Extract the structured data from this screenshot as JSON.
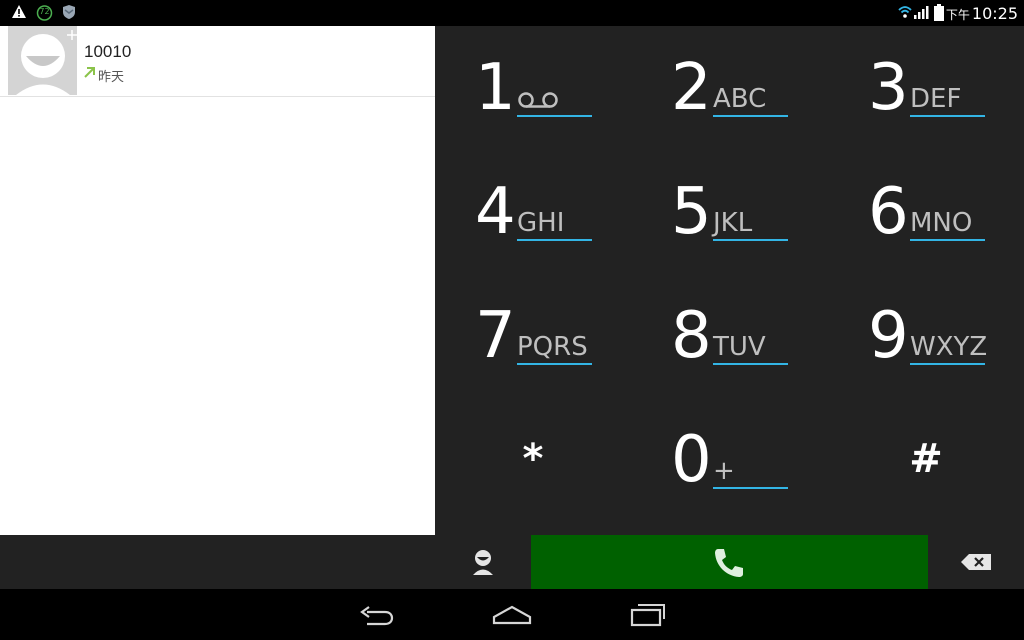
{
  "status_bar": {
    "left_icons": [
      "warning-icon",
      "badge-72-icon",
      "shield-icon"
    ],
    "badge_number": "72",
    "right_icons": [
      "wifi-icon",
      "signal-icon",
      "battery-icon"
    ],
    "ampm": "下午",
    "time": "10:25"
  },
  "call_log": {
    "entries": [
      {
        "number": "10010",
        "time": "昨天",
        "call_type": "outgoing-call-icon"
      }
    ]
  },
  "dialpad": {
    "keys": [
      {
        "digit": "1",
        "letters": "",
        "icon": "voicemail-icon"
      },
      {
        "digit": "2",
        "letters": "ABC"
      },
      {
        "digit": "3",
        "letters": "DEF"
      },
      {
        "digit": "4",
        "letters": "GHI"
      },
      {
        "digit": "5",
        "letters": "JKL"
      },
      {
        "digit": "6",
        "letters": "MNO"
      },
      {
        "digit": "7",
        "letters": "PQRS"
      },
      {
        "digit": "8",
        "letters": "TUV"
      },
      {
        "digit": "9",
        "letters": "WXYZ"
      },
      {
        "digit": "*",
        "letters": ""
      },
      {
        "digit": "0",
        "letters": "+"
      },
      {
        "digit": "#",
        "letters": ""
      }
    ]
  },
  "actions": {
    "contacts": "contacts-icon",
    "call": "phone-icon",
    "backspace": "backspace-icon"
  },
  "colors": {
    "accent_underline": "#33b5e5",
    "call_button": "#006100",
    "dialpad_bg": "#222222",
    "outgoing_arrow": "#8bc34a"
  },
  "nav_bar": [
    "back-icon",
    "home-icon",
    "recents-icon"
  ]
}
